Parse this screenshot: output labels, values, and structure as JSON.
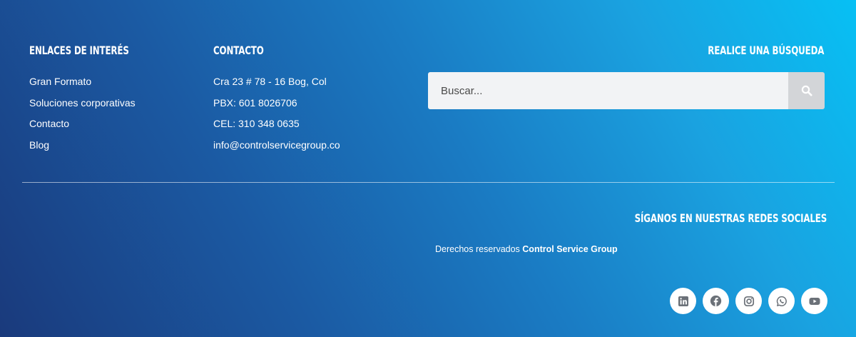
{
  "links": {
    "heading": "Enlaces de interés",
    "items": [
      "Gran Formato",
      "Soluciones corporativas",
      "Contacto",
      "Blog"
    ]
  },
  "contact": {
    "heading": "Contacto",
    "items": [
      "Cra 23 # 78 - 16 Bog, Col",
      "PBX: 601 8026706",
      "CEL: 310 348 0635",
      "info@controlservicegroup.co"
    ]
  },
  "search": {
    "heading": "Realice una búsqueda",
    "placeholder": "Buscar..."
  },
  "social": {
    "heading": "Síganos en nuestras redes sociales",
    "icons": [
      "linkedin-icon",
      "facebook-icon",
      "instagram-icon",
      "whatsapp-icon",
      "youtube-icon"
    ]
  },
  "copyright": {
    "prefix": "Derechos reservados ",
    "company": "Control Service Group"
  },
  "colors": {
    "icon": "#6b7178",
    "search_button": "#d3d5d8",
    "search_field": "#f2f3f5"
  }
}
